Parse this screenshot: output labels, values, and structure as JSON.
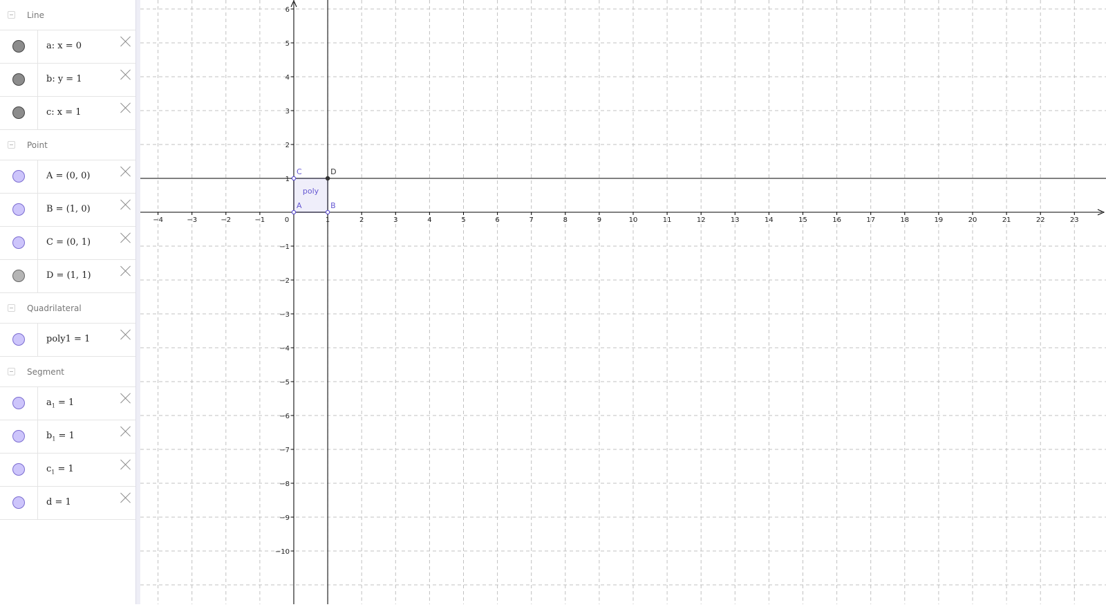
{
  "algebra": {
    "groups": [
      {
        "title": "Line",
        "items": [
          {
            "name": "a",
            "text": "a: x = 0",
            "marble": "dark"
          },
          {
            "name": "b",
            "text": "b: y = 1",
            "marble": "dark"
          },
          {
            "name": "c",
            "text": "c: x = 1",
            "marble": "dark"
          }
        ]
      },
      {
        "title": "Point",
        "items": [
          {
            "name": "A",
            "text": "A = (0, 0)",
            "marble": "purple"
          },
          {
            "name": "B",
            "text": "B = (1, 0)",
            "marble": "purple"
          },
          {
            "name": "C",
            "text": "C = (0, 1)",
            "marble": "purple"
          },
          {
            "name": "D",
            "text": "D = (1, 1)",
            "marble": "gray"
          }
        ]
      },
      {
        "title": "Quadrilateral",
        "items": [
          {
            "name": "poly1",
            "text": "poly1 = 1",
            "marble": "purple"
          }
        ]
      },
      {
        "title": "Segment",
        "items": [
          {
            "name": "a1",
            "text": "a",
            "sub": "1",
            "rest": " = 1",
            "marble": "purple"
          },
          {
            "name": "b1",
            "text": "b",
            "sub": "1",
            "rest": " = 1",
            "marble": "purple"
          },
          {
            "name": "c1",
            "text": "c",
            "sub": "1",
            "rest": " = 1",
            "marble": "purple"
          },
          {
            "name": "d",
            "text": "d = 1",
            "marble": "purple"
          }
        ]
      }
    ]
  },
  "graph": {
    "x_range": [
      -4.5,
      23.3
    ],
    "y_range": [
      -11.1,
      6.3
    ],
    "x_ticks": [
      -4,
      -3,
      -2,
      -1,
      0,
      1,
      2,
      3,
      4,
      5,
      6,
      7,
      8,
      9,
      10,
      11,
      12,
      13,
      14,
      15,
      16,
      17,
      18,
      19,
      20,
      21,
      22,
      23
    ],
    "y_ticks": [
      6,
      5,
      4,
      3,
      2,
      1,
      -1,
      -2,
      -3,
      -4,
      -5,
      -6,
      -7,
      -8,
      -9,
      -10
    ],
    "grid": true,
    "axis_color": "#000000",
    "grid_color": "#c0c0c0",
    "polygon": {
      "label": "poly",
      "fill": "#6557d2",
      "vertices": [
        [
          0,
          0
        ],
        [
          1,
          0
        ],
        [
          1,
          1
        ],
        [
          0,
          1
        ]
      ]
    },
    "points": [
      {
        "label": "A",
        "x": 0,
        "y": 0,
        "color": "#6557d2"
      },
      {
        "label": "B",
        "x": 1,
        "y": 0,
        "color": "#6557d2"
      },
      {
        "label": "C",
        "x": 0,
        "y": 1,
        "color": "#6557d2"
      },
      {
        "label": "D",
        "x": 1,
        "y": 1,
        "color": "#333333"
      }
    ],
    "lines": [
      {
        "name": "a",
        "type": "vertical",
        "value": 0
      },
      {
        "name": "b",
        "type": "horizontal",
        "value": 1
      },
      {
        "name": "c",
        "type": "vertical",
        "value": 1
      }
    ]
  }
}
